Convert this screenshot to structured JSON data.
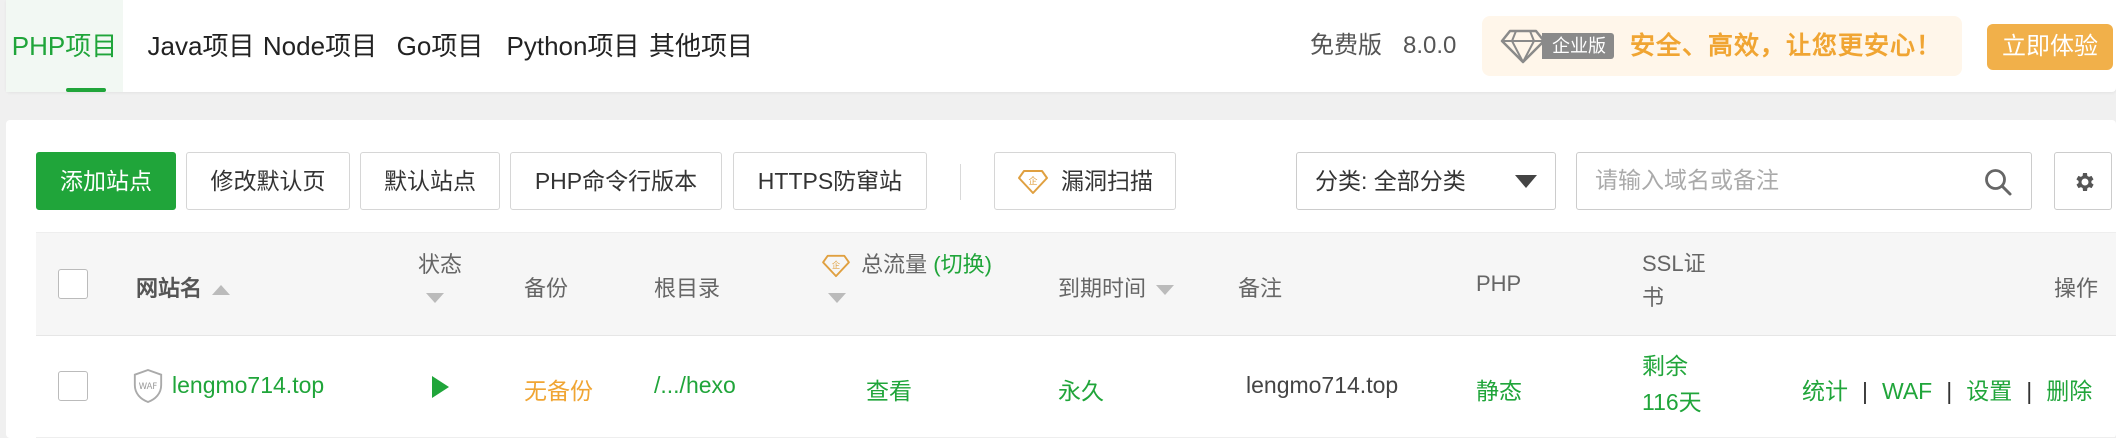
{
  "tabs": [
    "PHP项目",
    "Java项目",
    "Node项目",
    "Go项目",
    "Python项目",
    "其他项目"
  ],
  "active_tab": "PHP项目",
  "version": {
    "edition": "免费版",
    "number": "8.0.0"
  },
  "promo": {
    "badge": "企业版",
    "slogan": "安全、高效，让您更安心！",
    "try_label": "立即体验"
  },
  "toolbar": {
    "add_site": "添加站点",
    "modify_default_page": "修改默认页",
    "default_site": "默认站点",
    "php_cli_version": "PHP命令行版本",
    "https_anti_cross": "HTTPS防窜站",
    "vuln_scan": "漏洞扫描",
    "category_select": "分类: 全部分类",
    "search_placeholder": "请输入域名或备注"
  },
  "table": {
    "headers": {
      "site_name": "网站名",
      "status": "状态",
      "backup": "备份",
      "root_dir": "根目录",
      "traffic": "总流量",
      "traffic_switch": "(切换)",
      "expire": "到期时间",
      "remark": "备注",
      "php": "PHP",
      "ssl_line1": "SSL证",
      "ssl_line2": "书",
      "actions": "操作"
    },
    "rows": [
      {
        "site_name": "lengmo714.top",
        "waf_badge": "WAF",
        "backup": "无备份",
        "root_dir": "/.../hexo",
        "traffic": "查看",
        "expire": "永久",
        "remark": "lengmo714.top",
        "php": "静态",
        "ssl_line1": "剩余",
        "ssl_line2": "116天",
        "actions": [
          "统计",
          "WAF",
          "设置",
          "删除"
        ]
      }
    ]
  },
  "colors": {
    "primary": "#20a53a",
    "warning": "#f0a533",
    "promo_bg": "#fff6ea",
    "try_button": "#f1b04a"
  }
}
